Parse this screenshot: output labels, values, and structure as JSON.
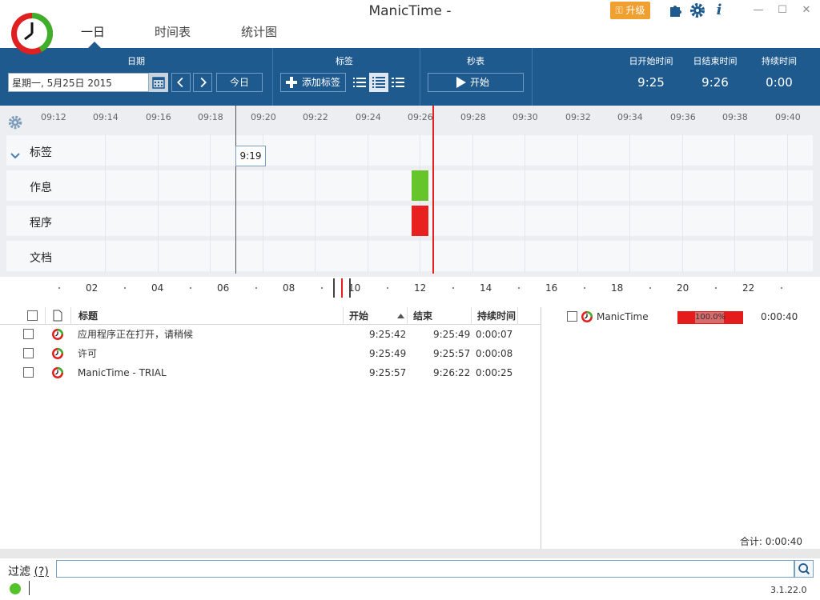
{
  "app": {
    "title": "ManicTime -",
    "upgrade_label": "升级"
  },
  "nav": {
    "tabs": [
      {
        "label": "一日"
      },
      {
        "label": "时间表"
      },
      {
        "label": "统计图"
      }
    ]
  },
  "toolbar": {
    "date_header": "日期",
    "date_value": "星期一, 5月25日 2015",
    "today_label": "今日",
    "tags_header": "标签",
    "add_tag_label": "添加标签",
    "stopwatch_header": "秒表",
    "start_label": "开始",
    "day_start_header": "日开始时间",
    "day_start_value": "9:25",
    "day_end_header": "日结束时间",
    "day_end_value": "9:26",
    "duration_header": "持续时间",
    "duration_value": "0:00"
  },
  "timeline": {
    "ticks": [
      "09:12",
      "09:14",
      "09:16",
      "09:18",
      "09:20",
      "09:22",
      "09:24",
      "09:26",
      "09:28",
      "09:30",
      "09:32",
      "09:34",
      "09:36",
      "09:38",
      "09:40"
    ],
    "lanes": [
      {
        "label": "标签"
      },
      {
        "label": "作息"
      },
      {
        "label": "程序"
      },
      {
        "label": "文档"
      }
    ],
    "cursor_time": "9:19",
    "activity_color": "#67c52c",
    "program_color": "#e82020"
  },
  "ruler": {
    "labels": [
      "02",
      "04",
      "06",
      "08",
      "10",
      "12",
      "14",
      "16",
      "18",
      "20",
      "22"
    ]
  },
  "table": {
    "headers": {
      "title": "标题",
      "start": "开始",
      "end": "结束",
      "duration": "持续时间"
    },
    "rows": [
      {
        "title": "应用程序正在打开，请稍候",
        "start": "9:25:42",
        "end": "9:25:49",
        "duration": "0:00:07"
      },
      {
        "title": "许可",
        "start": "9:25:49",
        "end": "9:25:57",
        "duration": "0:00:08"
      },
      {
        "title": "ManicTime - TRIAL",
        "start": "9:25:57",
        "end": "9:26:22",
        "duration": "0:00:25"
      }
    ]
  },
  "summary": {
    "app_name": "ManicTime",
    "percent": "100.0%",
    "time": "0:00:40",
    "total": "合计: 0:00:40"
  },
  "footer": {
    "filter_label": "过滤",
    "filter_help": "(?)",
    "filter_value": "",
    "version": "3.1.22.0"
  }
}
